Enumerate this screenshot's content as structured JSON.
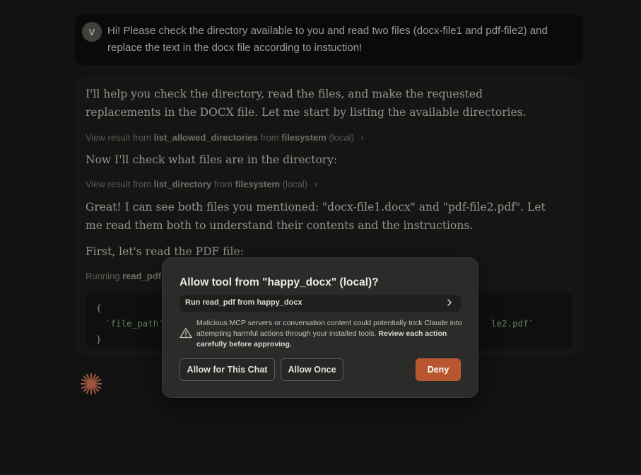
{
  "user_message": {
    "avatar_letter": "V",
    "text": "Hi! Please check the directory available to you and read two files (docx-file1 and pdf-file2) and replace the text in the docx file according to instuction!"
  },
  "assistant": {
    "intro": "I'll help you check the directory, read the files, and make the requested replacements in the DOCX file. Let me start by listing the available directories.",
    "view1": {
      "prefix": "View result from",
      "tool": "list_allowed_directories",
      "from": "from",
      "server": "filesystem",
      "scope": "(local)"
    },
    "step2": "Now I'll check what files are in the directory:",
    "view2": {
      "prefix": "View result from",
      "tool": "list_directory",
      "from": "from",
      "server": "filesystem",
      "scope": "(local)"
    },
    "found": "Great! I can see both files you mentioned: \"docx-file1.docx\" and \"pdf-file2.pdf\". Let me read them both to understand their contents and the instructions.",
    "first": "First, let's read the PDF file:",
    "running": {
      "prefix": "Running",
      "tool": "read_pdf"
    },
    "code": {
      "open": "{",
      "key": "`file_path`",
      "value_tail": "le2.pdf`",
      "close": "}"
    }
  },
  "dialog": {
    "title": "Allow tool from \"happy_docx\" (local)?",
    "tool_row": "Run read_pdf from happy_docx",
    "warning": "Malicious MCP servers or conversation content could potentially trick Claude into attempting harmful actions through your installed tools.",
    "warning_bold": "Review each action carefully before approving.",
    "buttons": {
      "allow_chat": "Allow for This Chat",
      "allow_once": "Allow Once",
      "deny": "Deny"
    }
  },
  "colors": {
    "background": "#1a1a19",
    "accent": "#b8562f",
    "spark": "#d97757"
  },
  "icons": {
    "spark": "claude-spark-icon",
    "warning": "warning-triangle-icon",
    "chevron": "chevron-right-icon"
  }
}
